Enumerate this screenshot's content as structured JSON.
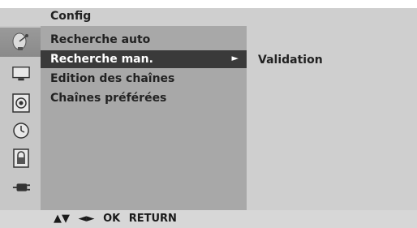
{
  "header": {
    "title": "Config"
  },
  "sidebar": {
    "icons": [
      {
        "name": "satellite-dish-icon",
        "active": true
      },
      {
        "name": "tv-screen-icon",
        "active": false
      },
      {
        "name": "speaker-icon",
        "active": false
      },
      {
        "name": "clock-icon",
        "active": false
      },
      {
        "name": "lock-icon",
        "active": false
      },
      {
        "name": "plug-icon",
        "active": false
      }
    ]
  },
  "menu": {
    "items": [
      {
        "label": "Recherche auto",
        "selected": false
      },
      {
        "label": "Recherche man.",
        "selected": true,
        "has_submenu": true
      },
      {
        "label": "Edition des chaînes",
        "selected": false
      },
      {
        "label": "Chaînes préférées",
        "selected": false
      }
    ],
    "submenu_arrow": "►"
  },
  "submenu": {
    "label": "Validation"
  },
  "footer": {
    "updown": "▲▼",
    "leftright": "◄►",
    "ok": "OK",
    "return": "RETURN"
  },
  "colors": {
    "header_bg": "#cfcfcf",
    "menu_bg": "#a8a8a8",
    "selected_bg": "#3a3a3a",
    "right_panel_bg": "#cfcfcf",
    "text": "#222222"
  }
}
